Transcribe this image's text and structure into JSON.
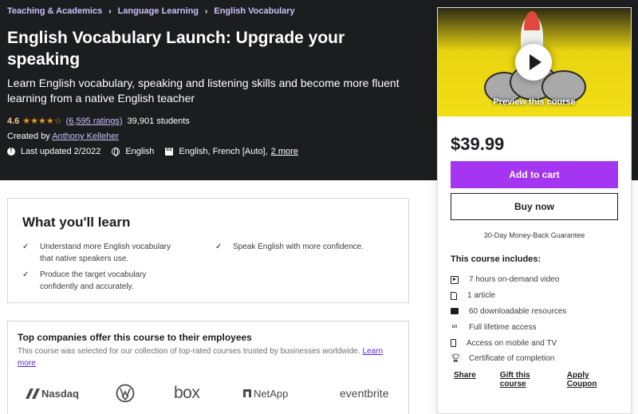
{
  "breadcrumbs": [
    "Teaching & Academics",
    "Language Learning",
    "English Vocabulary"
  ],
  "course": {
    "title": "English Vocabulary Launch: Upgrade your speaking",
    "subtitle": "Learn English vocabulary, speaking and listening skills and become more fluent learning from a native English teacher",
    "rating": "4.6",
    "stars": "★★★★☆",
    "ratings_count": "(6,595 ratings)",
    "students": "39,901 students",
    "created_by_label": "Created by",
    "instructor": "Anthony Kelleher",
    "last_updated": "Last updated 2/2022",
    "language": "English",
    "captions": "English, French [Auto],",
    "captions_more": "2 more"
  },
  "sidebar": {
    "preview_label": "Preview this course",
    "price": "$39.99",
    "add_to_cart": "Add to cart",
    "buy_now": "Buy now",
    "guarantee": "30-Day Money-Back Guarantee",
    "includes_title": "This course includes:",
    "includes": [
      {
        "icon": "video-icon",
        "text": "7 hours on-demand video"
      },
      {
        "icon": "article-icon",
        "text": "1 article"
      },
      {
        "icon": "download-icon",
        "text": "60 downloadable resources"
      },
      {
        "icon": "infinity-icon",
        "text": "Full lifetime access"
      },
      {
        "icon": "mobile-icon",
        "text": "Access on mobile and TV"
      },
      {
        "icon": "trophy-icon",
        "text": "Certificate of completion"
      }
    ],
    "links": [
      "Share",
      "Gift this course",
      "Apply Coupon"
    ]
  },
  "learn": {
    "title": "What you'll learn",
    "items": [
      "Understand more English vocabulary that native speakers use.",
      "Speak English with more confidence.",
      "Produce the target vocabulary confidently and accurately."
    ]
  },
  "companies": {
    "title": "Top companies offer this course to their employees",
    "text": "This course was selected for our collection of top-rated courses trusted by businesses worldwide.",
    "link": "Learn more",
    "logos": [
      "Nasdaq",
      "VW",
      "box",
      "NetApp",
      "eventbrite"
    ]
  },
  "colors": {
    "hero_bg": "#1c1d1f",
    "accent_purple": "#a435f0",
    "link_purple": "#cec0fc",
    "star_color": "#e59819"
  }
}
